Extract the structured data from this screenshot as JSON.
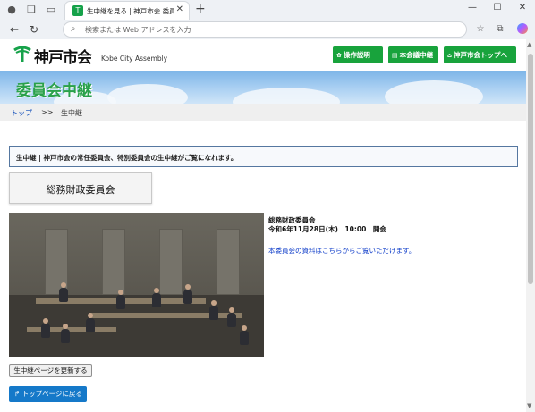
{
  "browser": {
    "tab_title": "生中継を見る | 神戸市会 委員会等",
    "address_placeholder": "検索または Web アドレスを入力"
  },
  "header": {
    "logo_text": "神戸市会",
    "logo_en": "Kobe City Assembly",
    "buttons": [
      {
        "label": "操作説明",
        "icon": "gear-icon"
      },
      {
        "label": "本会議中継",
        "icon": "list-icon"
      },
      {
        "label": "神戸市会トップへ",
        "icon": "home-icon"
      }
    ]
  },
  "banner": {
    "title": "委員会中継"
  },
  "breadcrumb": {
    "home": "トップ",
    "separator": ">>",
    "current": "生中継"
  },
  "notice": {
    "text": "生中継 | 神戸市会の常任委員会、特別委員会の生中継がご覧になれます。"
  },
  "committee": {
    "label": "総務財政委員会"
  },
  "video_info": {
    "name": "総務財政委員会",
    "date": "令和6年11月28日(木)　10:00　開会",
    "materials_link": "本委員会の資料はこちらからご覧いただけます。"
  },
  "actions": {
    "refresh_label": "生中継ページを更新する",
    "top_label": "トップページに戻る"
  },
  "colors": {
    "brand_green": "#18a33c",
    "link_blue": "#0a39c8",
    "top_button": "#1579c9"
  }
}
